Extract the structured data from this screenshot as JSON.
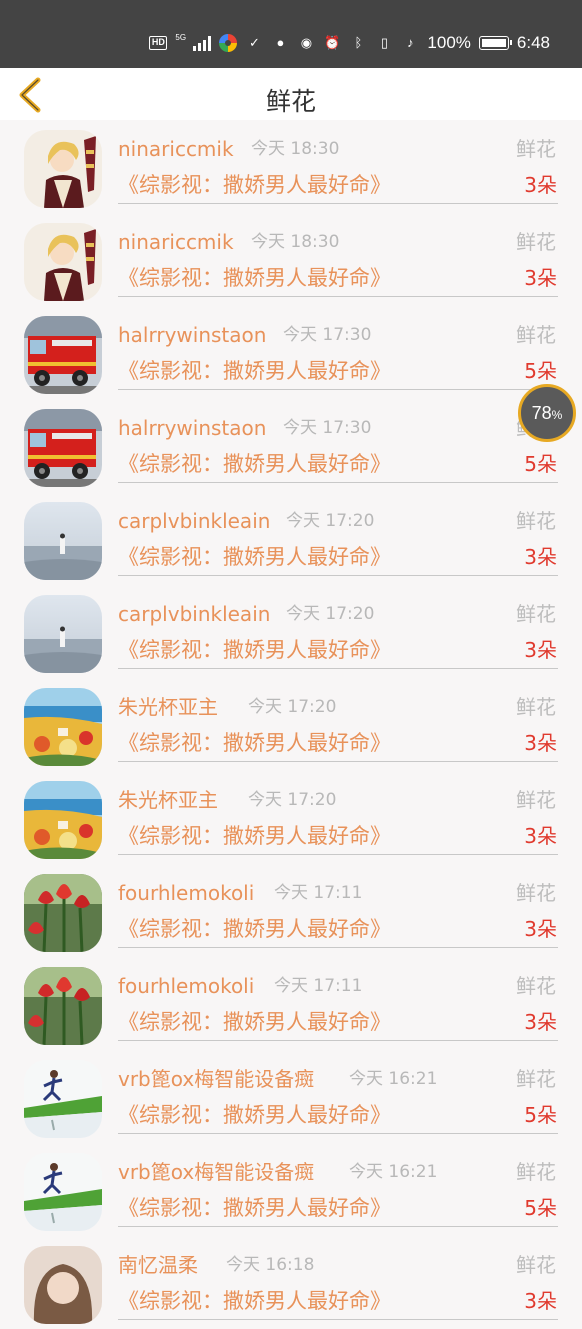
{
  "status_bar": {
    "hd": "HD",
    "network": "5G",
    "battery_percent": "100%",
    "time": "6:48",
    "battery_level": 1.0,
    "icons": [
      "hd-icon",
      "signal-icon",
      "color-wheel-icon",
      "nfc-icon",
      "qq-icon",
      "eye-icon",
      "alarm-icon",
      "bluetooth-icon",
      "vibrate-icon",
      "mute-icon",
      "battery-icon"
    ]
  },
  "header": {
    "back_icon": "chevron-left-icon",
    "title": "鲜花",
    "accent": "#e7a923"
  },
  "float_badge": {
    "value": "78",
    "unit": "%"
  },
  "rows": [
    {
      "name": "ninariccmik",
      "time": "今天 18:30",
      "gift": "鲜花",
      "book": "《综影视：撒娇男人最好命》",
      "count": "3朵",
      "avatar": "anime-avatar"
    },
    {
      "name": "ninariccmik",
      "time": "今天 18:30",
      "gift": "鲜花",
      "book": "《综影视：撒娇男人最好命》",
      "count": "3朵",
      "avatar": "anime-avatar"
    },
    {
      "name": "halrrywinstaon",
      "time": "今天 17:30",
      "gift": "鲜花",
      "book": "《综影视：撒娇男人最好命》",
      "count": "5朵",
      "avatar": "firetruck-avatar"
    },
    {
      "name": "halrrywinstaon",
      "time": "今天 17:30",
      "gift": "鲜花",
      "book": "《综影视：撒娇男人最好命》",
      "count": "5朵",
      "avatar": "firetruck-avatar"
    },
    {
      "name": "carplvbinkleain",
      "time": "今天 17:20",
      "gift": "鲜花",
      "book": "《综影视：撒娇男人最好命》",
      "count": "3朵",
      "avatar": "sea-avatar"
    },
    {
      "name": "carplvbinkleain",
      "time": "今天 17:20",
      "gift": "鲜花",
      "book": "《综影视：撒娇男人最好命》",
      "count": "3朵",
      "avatar": "sea-avatar"
    },
    {
      "name": "朱光杯亚主",
      "time": "今天 17:20",
      "gift": "鲜花",
      "book": "《综影视：撒娇男人最好命》",
      "count": "3朵",
      "avatar": "painting-avatar"
    },
    {
      "name": "朱光杯亚主",
      "time": "今天 17:20",
      "gift": "鲜花",
      "book": "《综影视：撒娇男人最好命》",
      "count": "3朵",
      "avatar": "painting-avatar"
    },
    {
      "name": "fourhlemokoli",
      "time": "今天 17:11",
      "gift": "鲜花",
      "book": "《综影视：撒娇男人最好命》",
      "count": "3朵",
      "avatar": "tulip-avatar"
    },
    {
      "name": "fourhlemokoli",
      "time": "今天 17:11",
      "gift": "鲜花",
      "book": "《综影视：撒娇男人最好命》",
      "count": "3朵",
      "avatar": "tulip-avatar"
    },
    {
      "name": "vrb篦ox梅智能设备癍",
      "time": "今天 16:21",
      "gift": "鲜花",
      "book": "《综影视：撒娇男人最好命》",
      "count": "5朵",
      "avatar": "runner-avatar"
    },
    {
      "name": "vrb篦ox梅智能设备癍",
      "time": "今天 16:21",
      "gift": "鲜花",
      "book": "《综影视：撒娇男人最好命》",
      "count": "5朵",
      "avatar": "runner-avatar"
    },
    {
      "name": "南忆温柔",
      "time": "今天 16:18",
      "gift": "鲜花",
      "book": "《综影视：撒娇男人最好命》",
      "count": "3朵",
      "avatar": "portrait-avatar"
    }
  ]
}
